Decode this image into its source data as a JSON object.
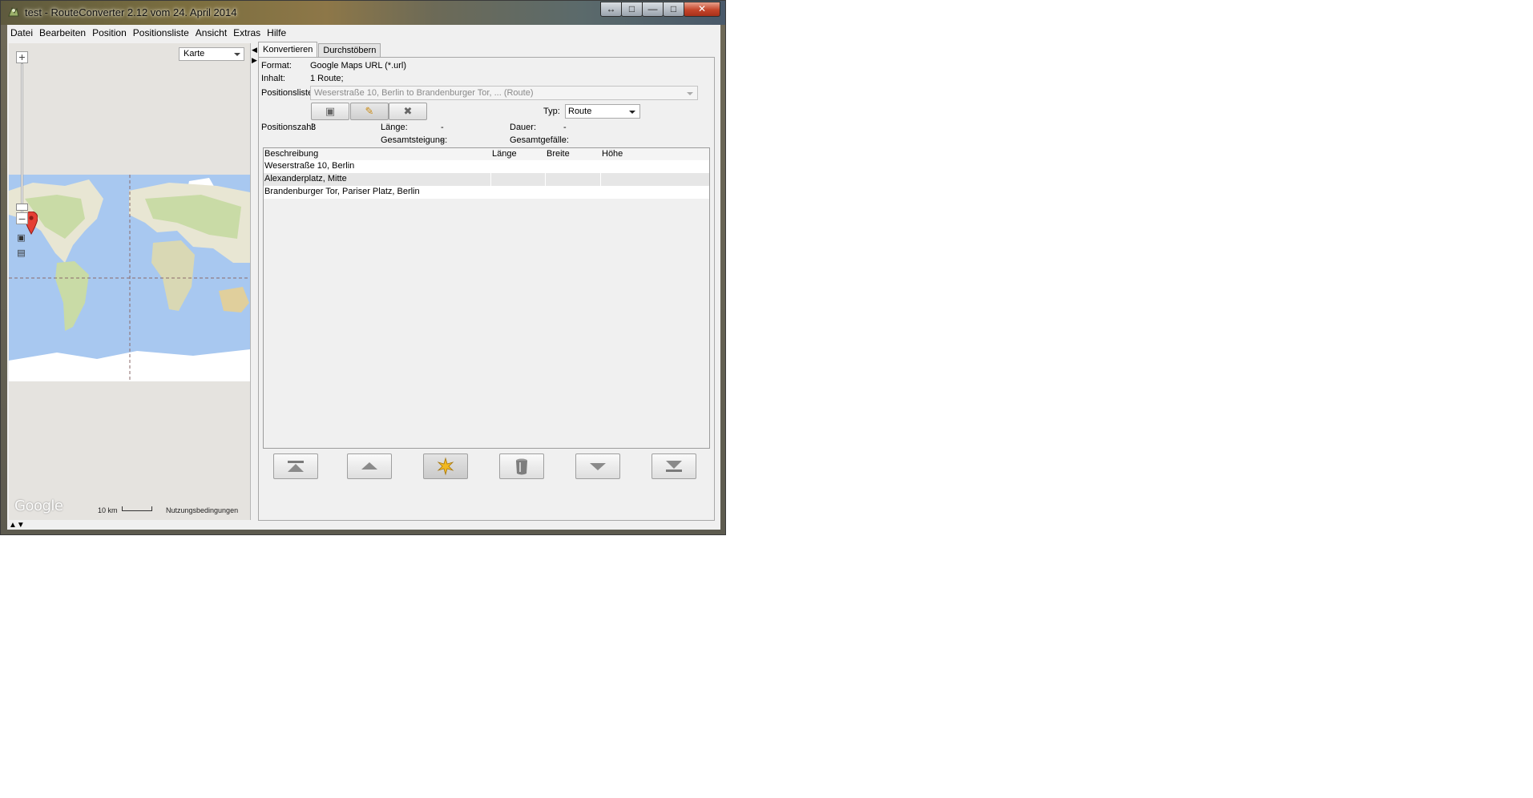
{
  "window": {
    "title": "test - RouteConverter 2.12 vom 24. April 2014"
  },
  "menu": [
    {
      "label": "Datei"
    },
    {
      "label": "Bearbeiten"
    },
    {
      "label": "Position"
    },
    {
      "label": "Positionsliste"
    },
    {
      "label": "Ansicht"
    },
    {
      "label": "Extras"
    },
    {
      "label": "Hilfe"
    }
  ],
  "map": {
    "type_select": "Karte",
    "logo": "Google",
    "scale": "10 km",
    "terms": "Nutzungsbedingungen"
  },
  "tabs": [
    {
      "label": "Konvertieren",
      "active": true
    },
    {
      "label": "Durchstöbern",
      "active": false
    }
  ],
  "convert": {
    "format_label": "Format:",
    "format_value": "Google Maps URL (*.url)",
    "content_label": "Inhalt:",
    "content_value": "1 Route;",
    "poslist_label": "Positionsliste:",
    "poslist_value": "Weserstraße 10, Berlin to Brandenburger Tor, ... (Route)",
    "type_label": "Typ:",
    "type_value": "Route",
    "stats": {
      "count_label": "Positionszahl:",
      "count_value": "3",
      "length_label": "Länge:",
      "length_value": "-",
      "duration_label": "Dauer:",
      "duration_value": "-",
      "ascent_label": "Gesamtsteigung:",
      "ascent_value": "-",
      "descent_label": "Gesamtgefälle:",
      "descent_value": "-"
    }
  },
  "table": {
    "columns": [
      "Beschreibung",
      "Länge",
      "Breite",
      "Höhe"
    ],
    "rows": [
      [
        "Weserstraße 10, Berlin",
        "",
        "",
        ""
      ],
      [
        "Alexanderplatz, Mitte",
        "",
        "",
        ""
      ],
      [
        "Brandenburger Tor, Pariser Platz, Berlin",
        "",
        "",
        ""
      ]
    ]
  },
  "icons": {
    "comment": "comment-icon",
    "edit": "pencil-icon",
    "delete": "close-icon",
    "top": "move-to-top-icon",
    "up": "move-up-icon",
    "new": "new-position-icon",
    "trash": "trash-can-icon",
    "down": "move-down-icon",
    "bottom": "move-to-bottom-icon"
  },
  "colors": {
    "map_water": "#a8c8f0",
    "map_land": "#e5e3df",
    "marker": "#e53f34",
    "close_button": "#c4452a"
  }
}
